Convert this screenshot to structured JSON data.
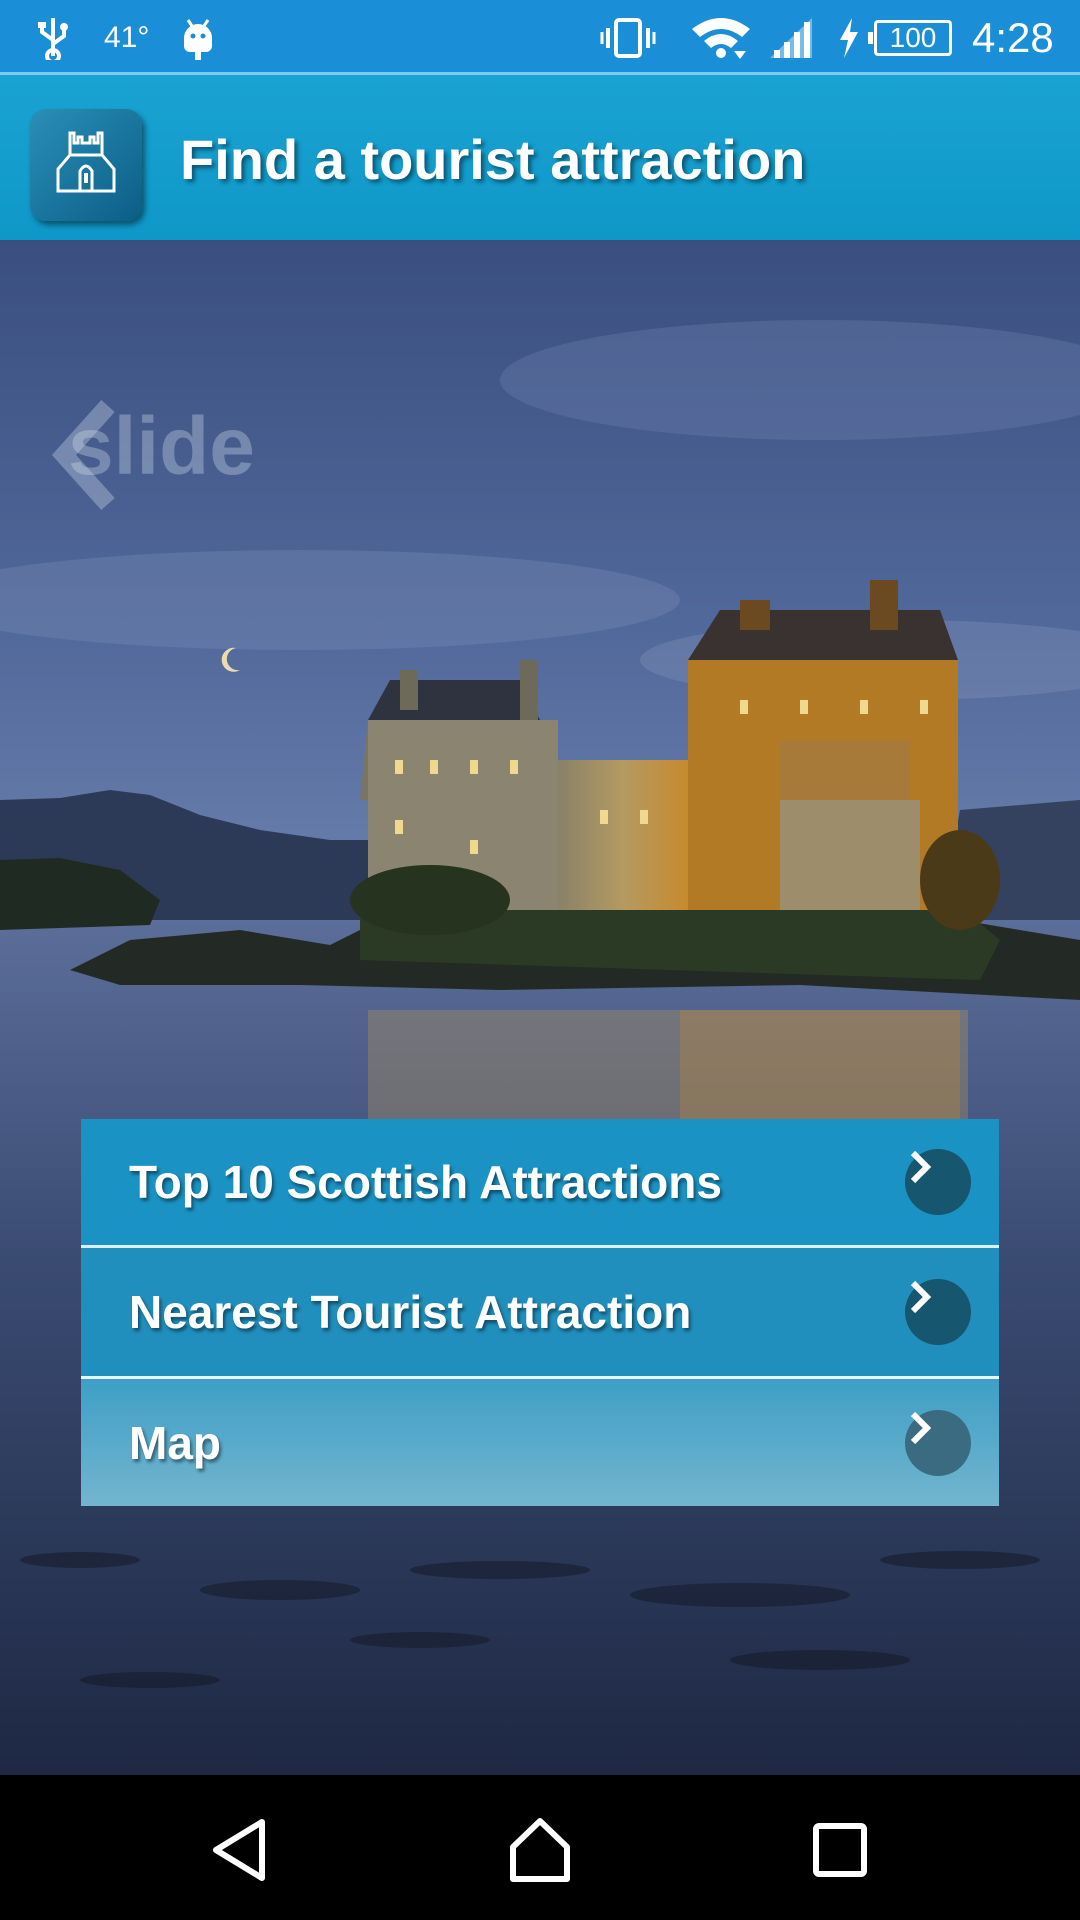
{
  "status_bar": {
    "temperature": "41°",
    "battery": "100",
    "time": "4:28",
    "icons": [
      "usb-icon",
      "android-debug-icon",
      "vibrate-icon",
      "wifi-icon",
      "signal-icon",
      "charging-icon",
      "battery-icon"
    ]
  },
  "app_bar": {
    "title": "Find a tourist attraction",
    "icon": "castle-icon"
  },
  "hero": {
    "slide_hint": "slide"
  },
  "menu": {
    "items": [
      {
        "label": "Top 10 Scottish Attractions"
      },
      {
        "label": "Nearest Tourist Attraction"
      },
      {
        "label": "Map"
      }
    ]
  },
  "nav_bar": {
    "buttons": [
      "back-icon",
      "home-icon",
      "recents-icon"
    ]
  },
  "colors": {
    "status_bar": "#1a8fd8",
    "app_bar": "#1aa3d2",
    "menu_item": "#1a92c3",
    "chevron_circle": "#17566f"
  }
}
